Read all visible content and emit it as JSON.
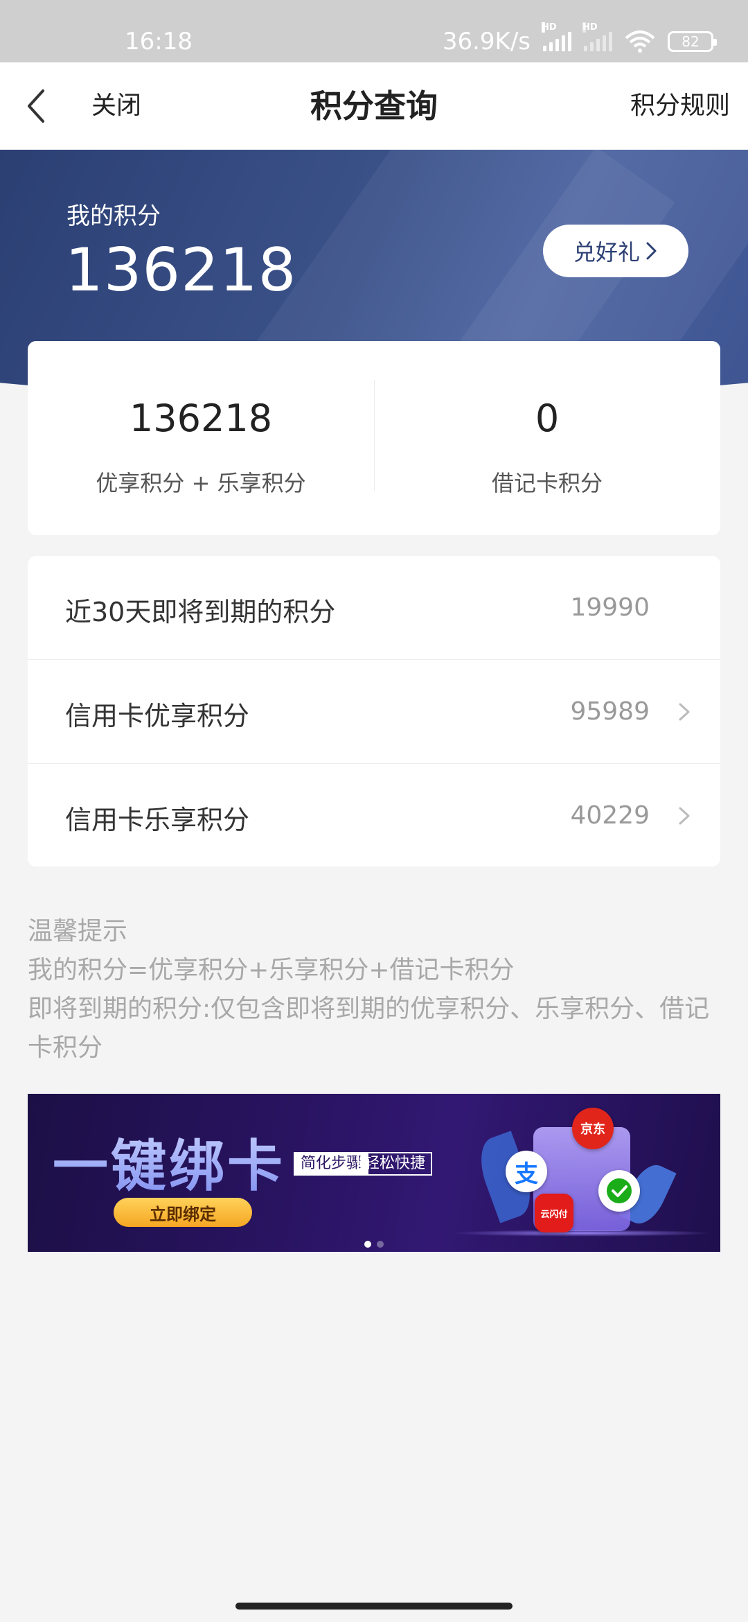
{
  "status_bar": {
    "time": "16:18",
    "network_speed": "36.9K/s",
    "battery": "82"
  },
  "nav": {
    "close_label": "关闭",
    "title": "积分查询",
    "rules_label": "积分规则"
  },
  "hero": {
    "label": "我的积分",
    "points": "136218",
    "redeem_label": "兑好礼",
    "color_start": "#2b3f73",
    "color_end": "#4a62a0"
  },
  "summary": {
    "left_value": "136218",
    "left_label": "优享积分 + 乐享积分",
    "right_value": "0",
    "right_label": "借记卡积分"
  },
  "details": [
    {
      "label": "近30天即将到期的积分",
      "value": "19990",
      "has_chevron": false
    },
    {
      "label": "信用卡优享积分",
      "value": "95989",
      "has_chevron": true
    },
    {
      "label": "信用卡乐享积分",
      "value": "40229",
      "has_chevron": true
    }
  ],
  "tips": {
    "title": "温馨提示",
    "line1": "我的积分=优享积分+乐享积分+借记卡积分",
    "line2": "即将到期的积分:仅包含即将到期的优享积分、乐享积分、借记卡积分"
  },
  "banner": {
    "title": "一键绑卡",
    "tag1": "简化步骤",
    "tag2": "轻松快捷",
    "button_label": "立即绑定",
    "app_icons": [
      "jd-icon",
      "alipay-icon",
      "wechat-pay-icon",
      "unionpay-icon"
    ],
    "jd_text": "京东",
    "alipay_text": "支",
    "unionpay_text": "云闪付",
    "active_slide": 0,
    "slide_count": 2
  }
}
